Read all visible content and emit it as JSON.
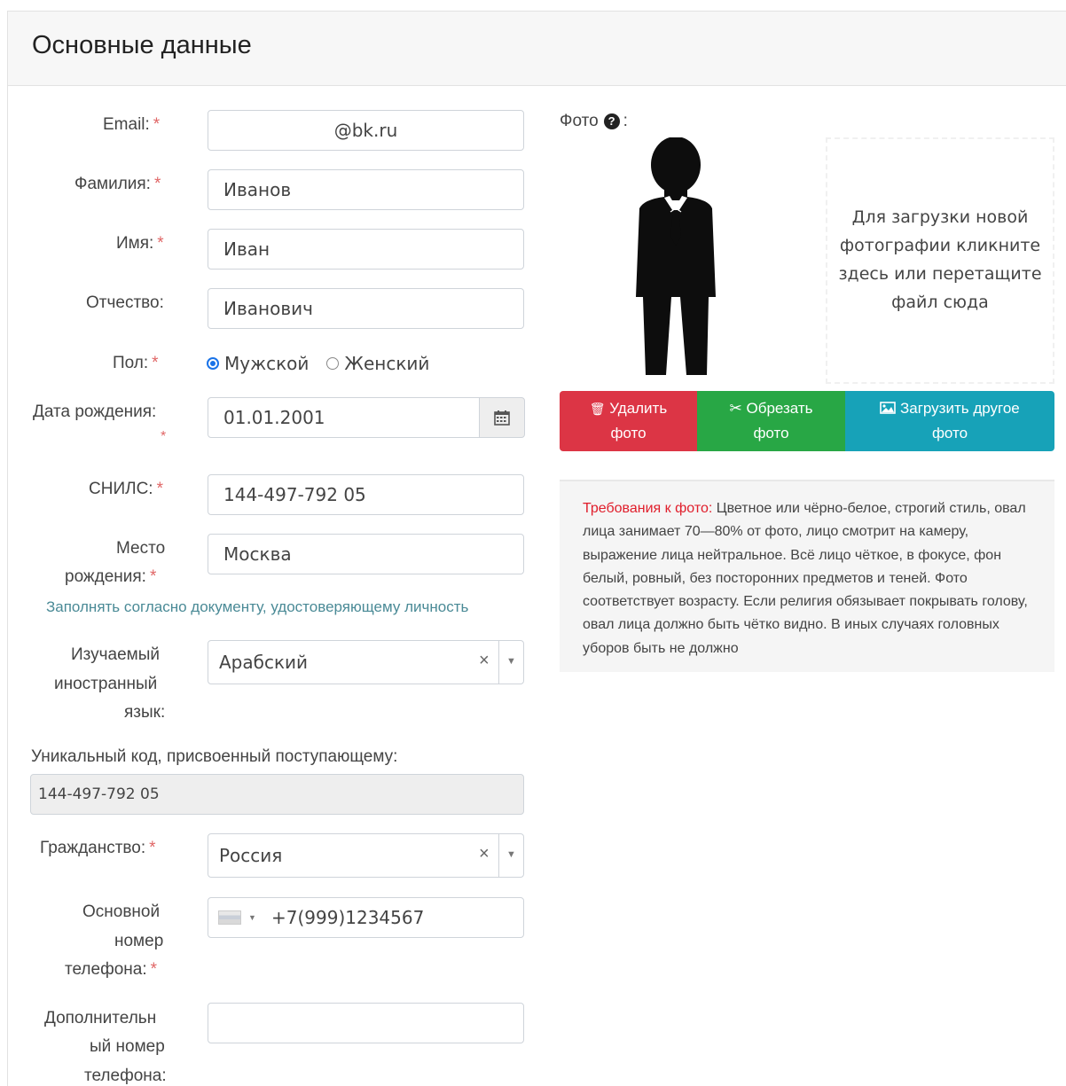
{
  "panel": {
    "title": "Основные данные"
  },
  "form": {
    "email": {
      "label": "Email:",
      "value": "@bk.ru"
    },
    "surname": {
      "label": "Фамилия:",
      "value": "Иванов"
    },
    "name": {
      "label": "Имя:",
      "value": "Иван"
    },
    "patronymic": {
      "label": "Отчество:",
      "value": "Иванович"
    },
    "gender": {
      "label": "Пол:",
      "options": [
        "Мужской",
        "Женский"
      ],
      "selected": "Мужской"
    },
    "birthdate": {
      "label": "Дата рождения:",
      "value": "01.01.2001"
    },
    "snils": {
      "label": "СНИЛС:",
      "value": "144-497-792 05"
    },
    "birthplace": {
      "label_line1": "Место",
      "label_line2": "рождения:",
      "value": "Москва"
    },
    "hint": "Заполнять согласно документу, удостоверяющему личность",
    "language": {
      "label_line1": "Изучаемый",
      "label_line2": "иностранный",
      "label_line3": "язык:",
      "value": "Арабский",
      "clear": "×"
    },
    "unique_code": {
      "label": "Уникальный код, присвоенный поступающему:",
      "value": "144-497-792 05"
    },
    "citizenship": {
      "label": "Гражданство:",
      "value": "Россия",
      "clear": "×"
    },
    "phone_main": {
      "label_line1": "Основной",
      "label_line2": "номер",
      "label_line3": "телефона:",
      "value": "+7(999)1234567"
    },
    "phone_extra": {
      "label_line1": "Дополнительн",
      "label_line2": "ый номер",
      "label_line3": "телефона:",
      "value": ""
    },
    "required_mark": "*"
  },
  "photo": {
    "label": "Фото",
    "label_suffix": ":",
    "help_icon": "?",
    "dropzone_text": "Для загрузки новой фотографии кликните здесь или перетащите файл сюда",
    "buttons": {
      "delete": {
        "line1": "Удалить",
        "line2": "фото",
        "icon": "trash-icon"
      },
      "crop": {
        "line1": "Обрезать",
        "line2": "фото",
        "icon": "scissors-icon"
      },
      "upload": {
        "line1": "Загрузить другое",
        "line2": "фото",
        "icon": "image-icon"
      }
    },
    "requirements_title": "Требования к фото:",
    "requirements_text": " Цветное или чёрно-белое, строгий стиль, овал лица занимает 70—80% от фото, лицо смотрит на камеру, выражение лица нейтральное. Всё лицо чёткое, в фокусе, фон белый, ровный, без посторонних предметов и теней. Фото соответствует возрасту. Если религия обязывает покрывать голову, овал лица должно быть чётко видно. В иных случаях головных уборов быть не должно"
  },
  "colors": {
    "danger": "#dc3545",
    "success": "#28a745",
    "info": "#17a2b8",
    "required": "#e06666"
  }
}
